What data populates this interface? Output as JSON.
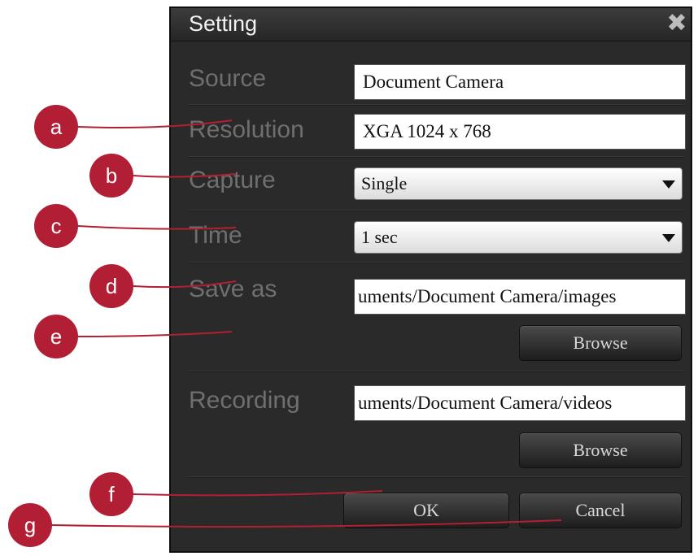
{
  "dialog": {
    "title": "Setting",
    "close_icon": "close-icon",
    "labels": {
      "source": "Source",
      "resolution": "Resolution",
      "capture": "Capture",
      "time": "Time",
      "save_as": "Save as",
      "recording": "Recording"
    },
    "fields": {
      "source_value": "Document Camera",
      "resolution_value": "XGA 1024 x 768",
      "capture_selected": "Single",
      "time_selected": "1 sec",
      "save_as_path": "uments/Document Camera/images",
      "recording_path": "uments/Document Camera/videos"
    },
    "buttons": {
      "browse_images": "Browse",
      "browse_videos": "Browse",
      "ok": "OK",
      "cancel": "Cancel"
    }
  },
  "callouts": [
    "a",
    "b",
    "c",
    "d",
    "e",
    "f",
    "g"
  ],
  "colors": {
    "callout": "#b21f35",
    "dialog_bg": "#2a2a2a",
    "label_text": "#6f6f6f"
  }
}
